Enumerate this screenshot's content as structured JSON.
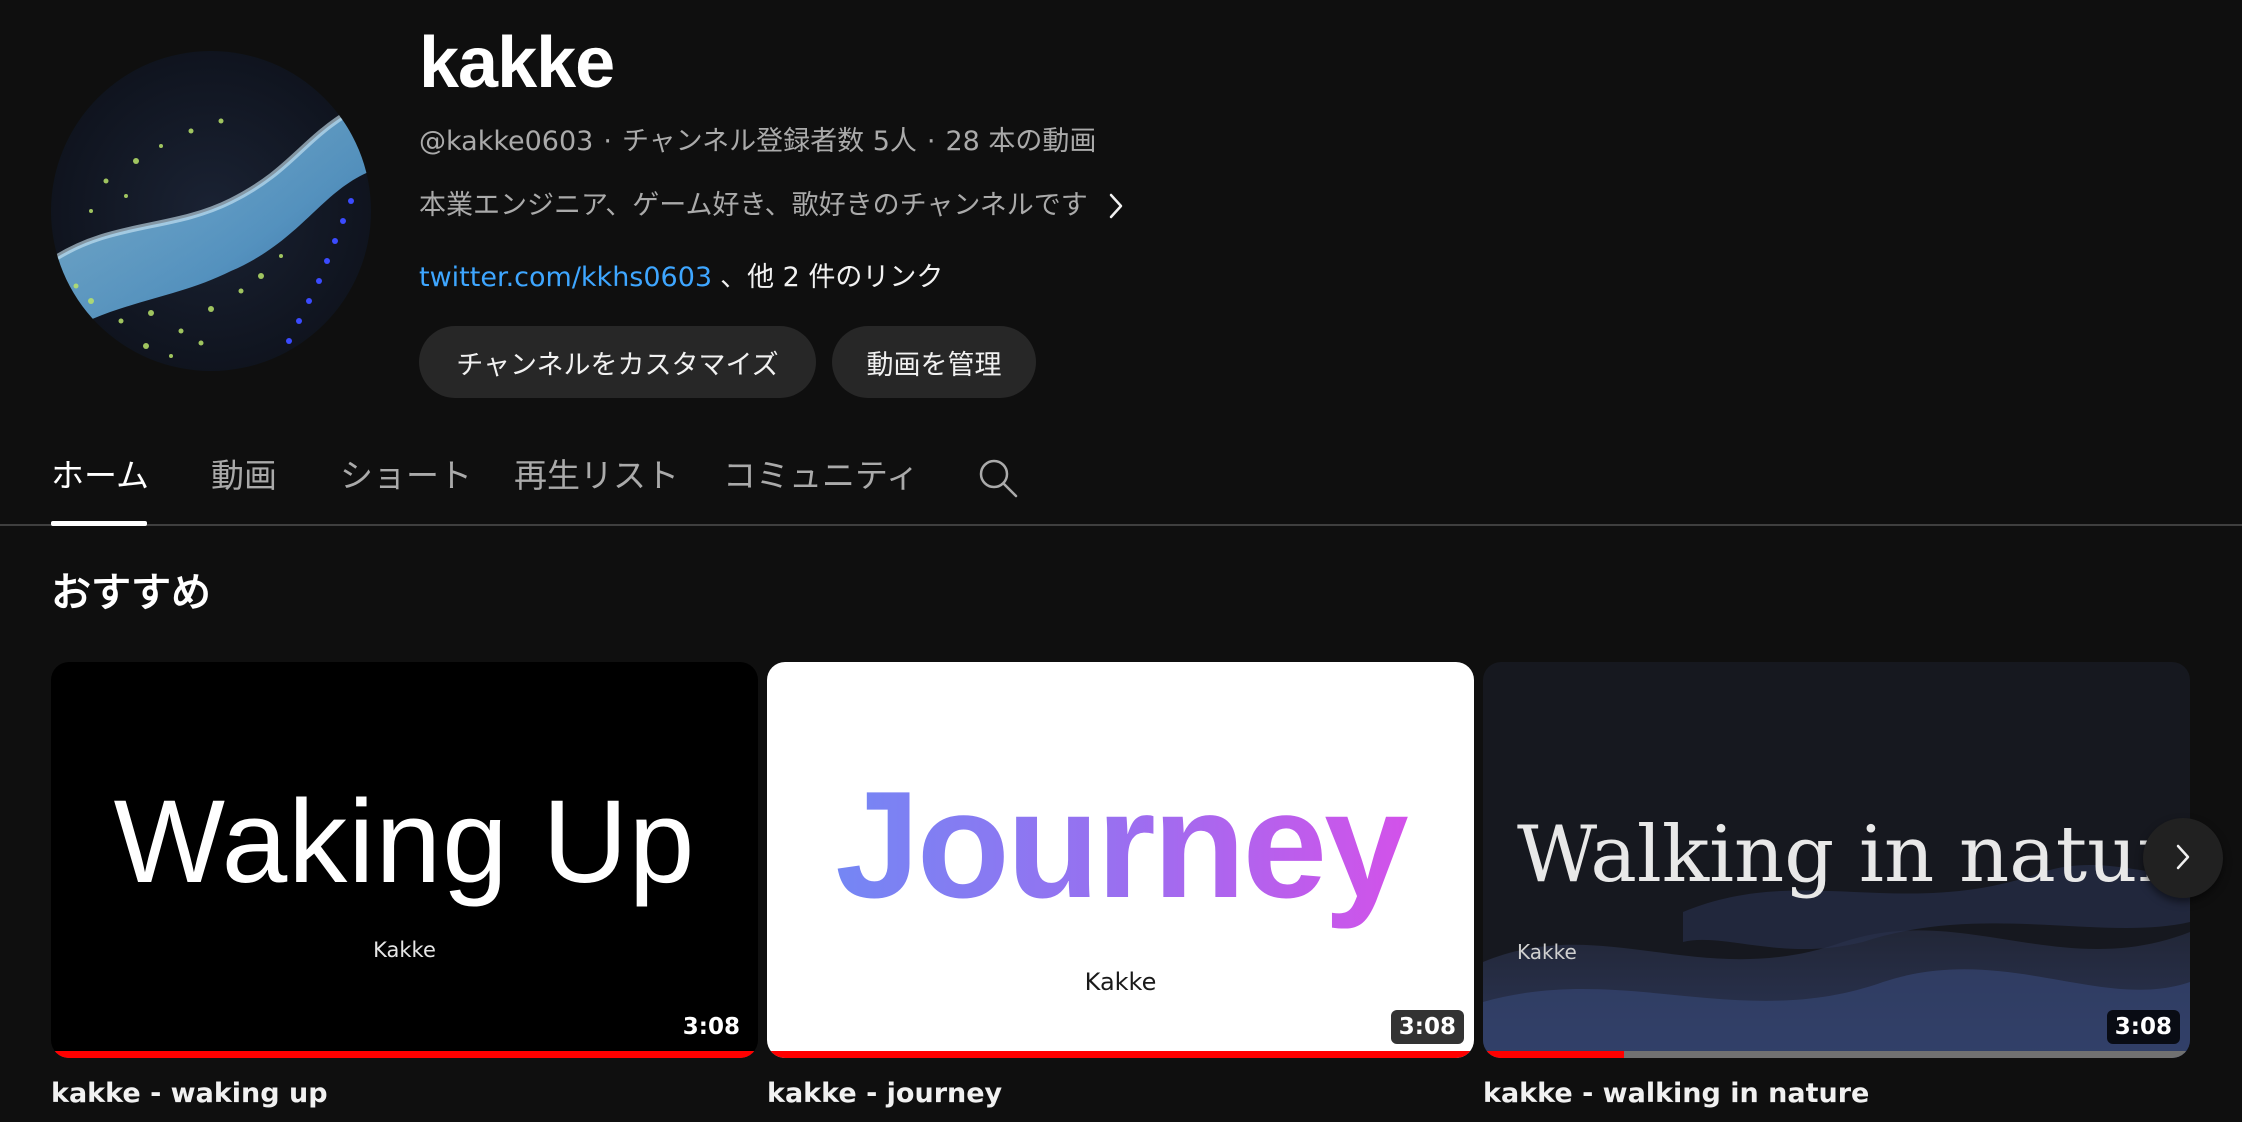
{
  "channel": {
    "name": "kakke",
    "handle": "@kakke0603",
    "separator": "·",
    "subscribers": "チャンネル登録者数 5人",
    "video_count": "28 本の動画",
    "description": "本業エンジニア、ゲーム好き、歌好きのチャンネルです",
    "link_text": "twitter.com/kkhs0603",
    "more_links": "、他 2 件のリンク"
  },
  "buttons": {
    "customize": "チャンネルをカスタマイズ",
    "manage": "動画を管理"
  },
  "tabs": [
    {
      "label": "ホーム",
      "active": true
    },
    {
      "label": "動画",
      "active": false
    },
    {
      "label": "ショート",
      "active": false
    },
    {
      "label": "再生リスト",
      "active": false
    },
    {
      "label": "コミュニティ",
      "active": false
    }
  ],
  "section": {
    "title": "おすすめ"
  },
  "videos": [
    {
      "title": "kakke - waking up",
      "thumb_text": "Waking Up",
      "thumb_sub": "Kakke",
      "duration": "3:08",
      "progress": 1.0
    },
    {
      "title": "kakke - journey",
      "thumb_text": "Journey",
      "thumb_sub": "Kakke",
      "duration": "3:08",
      "progress": 1.0
    },
    {
      "title": "kakke - walking in nature",
      "thumb_text": "Walking in nature",
      "thumb_sub": "Kakke",
      "duration": "3:08",
      "progress": 0.2
    }
  ],
  "icons": {
    "description_more": "chevron-right-icon",
    "tab_search": "search-icon",
    "carousel_next": "chevron-right-icon"
  },
  "colors": {
    "background": "#0f0f0f",
    "link": "#3ea6ff",
    "progress": "#ff0000",
    "button_bg": "#272727"
  }
}
